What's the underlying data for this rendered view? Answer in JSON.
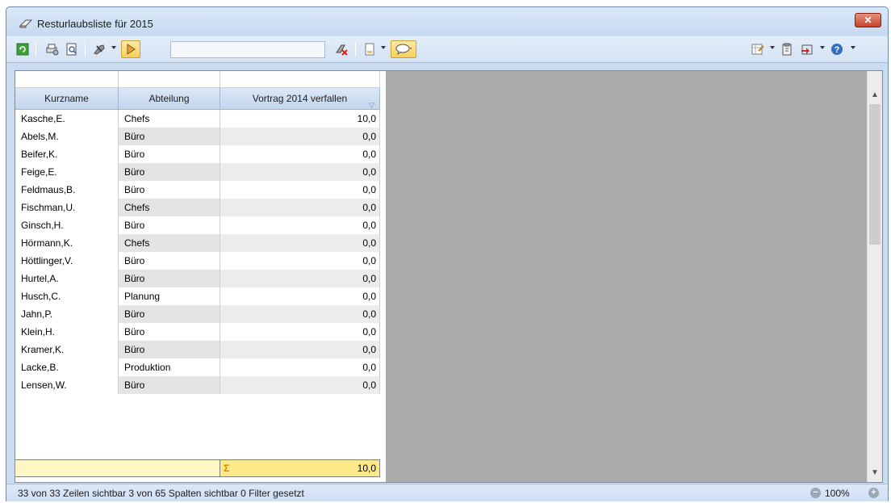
{
  "window": {
    "title": "Resturlaubsliste für 2015",
    "close_label": "✕"
  },
  "toolbar": {
    "search_value": "",
    "icons": [
      "refresh-icon",
      "print-setup-icon",
      "print-preview-icon",
      "tools-icon",
      "filter-icon",
      "settings-icon",
      "document-icon",
      "comment-icon",
      "export-icon",
      "clipboard-icon",
      "exit-icon",
      "help-icon"
    ]
  },
  "table": {
    "columns": [
      "Kurzname",
      "Abteilung",
      "Vortrag 2014 verfallen"
    ],
    "rows": [
      [
        "Kasche,E.",
        "Chefs",
        "10,0"
      ],
      [
        "Abels,M.",
        "Büro",
        "0,0"
      ],
      [
        "Beifer,K.",
        "Büro",
        "0,0"
      ],
      [
        "Feige,E.",
        "Büro",
        "0,0"
      ],
      [
        "Feldmaus,B.",
        "Büro",
        "0,0"
      ],
      [
        "Fischman,U.",
        "Chefs",
        "0,0"
      ],
      [
        "Ginsch,H.",
        "Büro",
        "0,0"
      ],
      [
        "Hörmann,K.",
        "Chefs",
        "0,0"
      ],
      [
        "Höttlinger,V.",
        "Büro",
        "0,0"
      ],
      [
        "Hurtel,A.",
        "Büro",
        "0,0"
      ],
      [
        "Husch,C.",
        "Planung",
        "0,0"
      ],
      [
        "Jahn,P.",
        "Büro",
        "0,0"
      ],
      [
        "Klein,H.",
        "Büro",
        "0,0"
      ],
      [
        "Kramer,K.",
        "Büro",
        "0,0"
      ],
      [
        "Lacke,B.",
        "Produktion",
        "0,0"
      ],
      [
        "Lensen,W.",
        "Büro",
        "0,0"
      ]
    ],
    "total_symbol": "Σ",
    "total": "10,0"
  },
  "status": {
    "text": "33 von 33 Zeilen sichtbar   3 von 65 Spalten sichtbar   0 Filter gesetzt",
    "zoom": "100%",
    "zoom_out": "−",
    "zoom_in": "+"
  },
  "colors": {
    "title_bg": "#c6d9f0",
    "close_btn": "#c7432b",
    "sum_bg": "#fbe98a",
    "footer_bg": "#fdf7c4",
    "empty_area": "#ababab"
  }
}
